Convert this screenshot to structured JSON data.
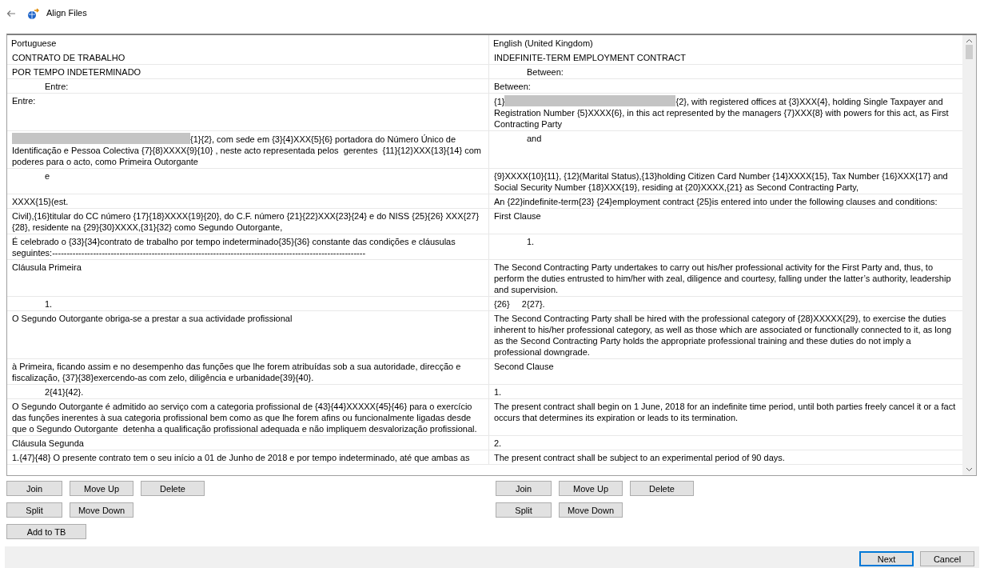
{
  "window": {
    "title": "Align Files"
  },
  "table": {
    "columns": [
      "Portuguese",
      "English (United Kingdom)"
    ],
    "rows": [
      [
        {
          "text": "CONTRATO DE TRABALHO"
        },
        {
          "text": "INDEFINITE-TERM EMPLOYMENT CONTRACT"
        }
      ],
      [
        {
          "text": "POR TEMPO INDETERMINADO"
        },
        {
          "text": "Between:",
          "indented": true
        }
      ],
      [
        {
          "text": "Entre:",
          "indented": true
        },
        {
          "text": "Between:"
        }
      ],
      [
        {
          "text": "Entre:"
        },
        {
          "prefix": "{1}",
          "redacted": true,
          "text": "{2}, with registered offices at {3}XXX{4}, holding Single Taxpayer and Registration Number {5}XXXX{6}, in this act represented by the managers {7}XXX{8} with powers for this act, as First Contracting Party"
        }
      ],
      [
        {
          "redacted": true,
          "text": "{1}{2}, com sede em {3}{4}XXX{5}{6} portadora do Número Único de Identificação e Pessoa Colectiva {7}{8}XXXX{9}{10} , neste acto representada pelos  gerentes  {11}{12}XXX{13}{14} com poderes para o acto, como Primeira Outorgante"
        },
        {
          "text": "and",
          "indented": true
        }
      ],
      [
        {
          "text": "e",
          "indented": true
        },
        {
          "text": "{9}XXXX{10}{11}, {12}(Marital Status),{13}holding Citizen Card Number {14}XXXX{15}, Tax Number {16}XXX{17} and Social Security Number {18}XXX{19}, residing at {20}XXXX,{21} as Second Contracting Party,"
        }
      ],
      [
        {
          "text": "XXXX{15}(est."
        },
        {
          "text": "An {22}indefinite-term{23} {24}employment contract {25}is entered into under the following clauses and conditions:"
        }
      ],
      [
        {
          "text": "Civil),{16}titular do CC número {17}{18}XXXX{19}{20}, do C.F. número {21}{22}XXX{23}{24} e do NISS {25}{26} XXX{27}{28}, residente na {29}{30}XXXX,{31}{32} como Segundo Outorgante,"
        },
        {
          "text": "First Clause"
        }
      ],
      [
        {
          "text": "É celebrado o {33}{34}contrato de trabalho por tempo indeterminado{35}{36} constante das condições e cláusulas seguintes:-----------------------------------------------------------------------------------------------------------"
        },
        {
          "text": "1.",
          "indented": true
        }
      ],
      [
        {
          "text": "Cláusula Primeira"
        },
        {
          "text": "The Second Contracting Party undertakes to carry out his/her professional activity for the First Party and, thus, to perform the duties entrusted to him/her with zeal, diligence and courtesy, falling under the latter’s authority, leadership and supervision."
        }
      ],
      [
        {
          "text": "1.",
          "indented": true
        },
        {
          "text": "{26}     2{27}."
        }
      ],
      [
        {
          "text": "O Segundo Outorgante obriga-se a prestar a sua actividade profissional"
        },
        {
          "text": "The Second Contracting Party shall be hired with the professional category of {28}XXXXX{29}, to exercise the duties inherent to his/her professional category, as well as those which are associated or functionally connected to it, as long as the Second Contracting Party holds the appropriate professional training and these duties do not imply a professional downgrade."
        }
      ],
      [
        {
          "text": "à Primeira, ficando assim e no desempenho das funções que lhe forem atribuídas sob a sua autoridade, direcção e fiscalização, {37}{38}exercendo-as com zelo, diligência e urbanidade{39}{40}."
        },
        {
          "text": "Second Clause"
        }
      ],
      [
        {
          "text": "2{41}{42}.",
          "indented": true
        },
        {
          "text": "1."
        }
      ],
      [
        {
          "text": "O Segundo Outorgante é admitido ao serviço com a categoria profissional de {43}{44}XXXXX{45}{46} para o exercício das funções inerentes à sua categoria profissional bem como as que lhe forem afins ou funcionalmente ligadas desde que o Segundo Outorgante  detenha a qualificação profissional adequada e não impliquem desvalorização profissional."
        },
        {
          "text": "The present contract shall begin on 1 June, 2018 for an indefinite time period, until both parties freely cancel it or a fact occurs that determines its expiration or leads to its termination."
        }
      ],
      [
        {
          "text": "Cláusula Segunda"
        },
        {
          "text": "2."
        }
      ],
      [
        {
          "text": "1.{47}{48} O presente contrato tem o seu início a 01 de Junho de 2018 e por tempo indeterminado, até que ambas as"
        },
        {
          "text": "The present contract shall be subject to an experimental period of 90 days."
        }
      ]
    ]
  },
  "left_buttons": [
    [
      "Join",
      "Move Up",
      "Delete"
    ],
    [
      "Split",
      "Move Down"
    ],
    [
      "Add to TB"
    ]
  ],
  "right_buttons": [
    [
      "Join",
      "Move Up",
      "Delete"
    ],
    [
      "Split",
      "Move Down"
    ]
  ],
  "footer_buttons": [
    {
      "label": "Next",
      "selected": true
    },
    {
      "label": "Cancel",
      "selected": false
    }
  ]
}
